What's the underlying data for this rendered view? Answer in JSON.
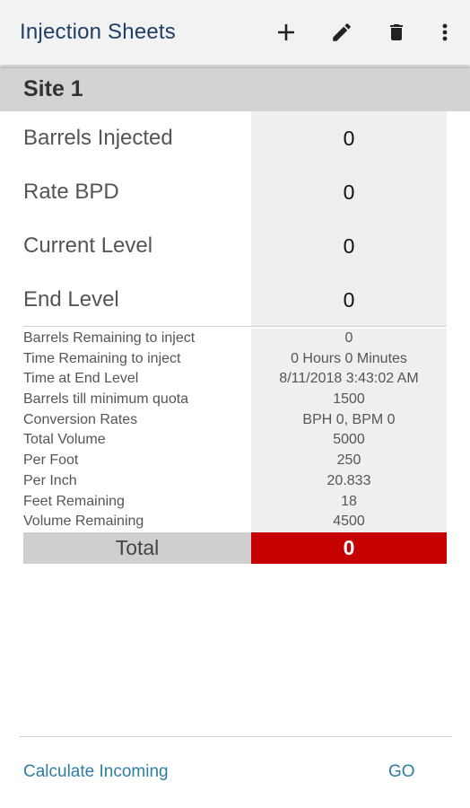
{
  "app_bar": {
    "title": "Injection Sheets",
    "actions": [
      {
        "icon": "add-icon"
      },
      {
        "icon": "edit-icon"
      },
      {
        "icon": "delete-icon"
      },
      {
        "icon": "more-vert-icon"
      }
    ]
  },
  "site": {
    "title": "Site 1"
  },
  "primary_rows": [
    {
      "label": "Barrels Injected",
      "value": "0"
    },
    {
      "label": "Rate BPD",
      "value": "0"
    },
    {
      "label": "Current Level",
      "value": "0"
    },
    {
      "label": "End Level",
      "value": "0"
    }
  ],
  "detail_rows": [
    {
      "label": "Barrels Remaining to inject",
      "value": "0"
    },
    {
      "label": "Time Remaining to inject",
      "value": "0 Hours 0 Minutes"
    },
    {
      "label": "Time at End Level",
      "value": "8/11/2018 3:43:02 AM"
    },
    {
      "label": "Barrels till minimum quota",
      "value": "1500"
    },
    {
      "label": "Conversion Rates",
      "value": "BPH 0, BPM 0"
    },
    {
      "label": "Total Volume",
      "value": "5000"
    },
    {
      "label": "Per Foot",
      "value": "250"
    },
    {
      "label": "Per Inch",
      "value": "20.833"
    },
    {
      "label": "Feet Remaining",
      "value": "18"
    },
    {
      "label": "Volume Remaining",
      "value": "4500"
    }
  ],
  "total": {
    "label": "Total",
    "value": "0"
  },
  "footer": {
    "left_action": "Calculate Incoming",
    "right_action": "GO"
  },
  "colors": {
    "title": "#1f3f66",
    "total_highlight": "#c40000",
    "link": "#2e7da6"
  }
}
